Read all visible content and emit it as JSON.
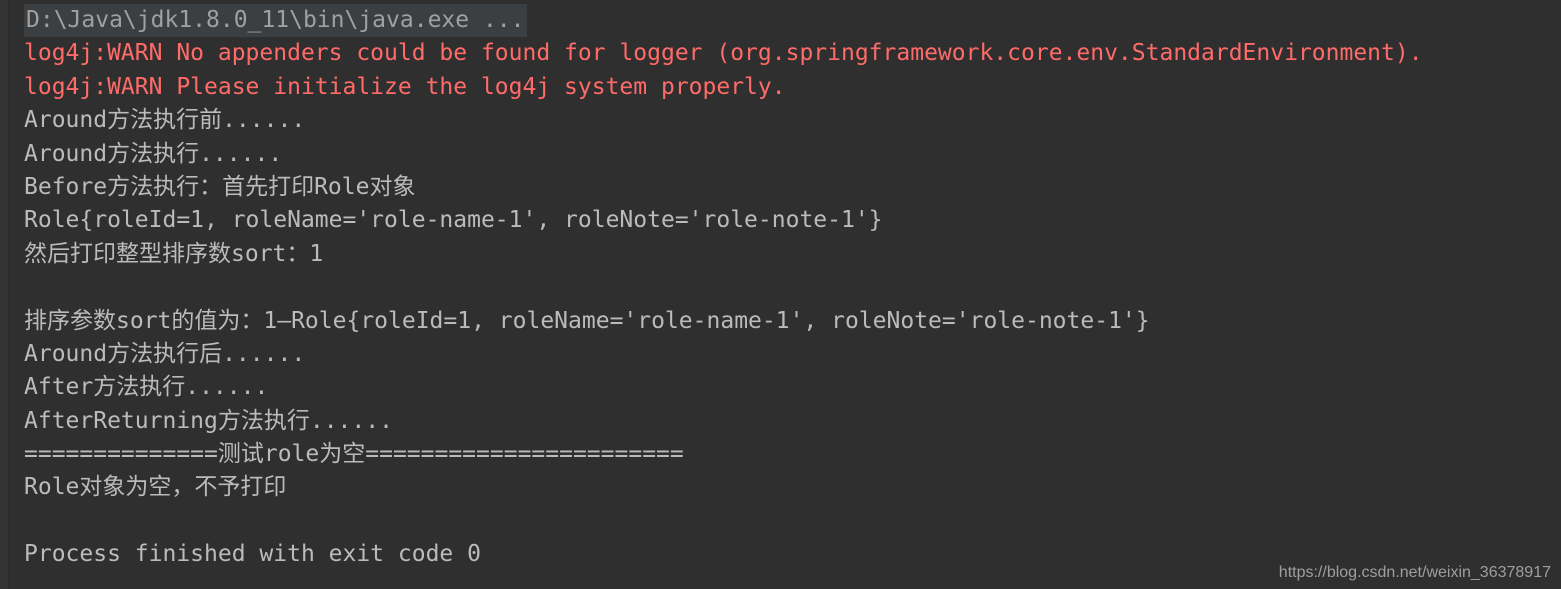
{
  "window": {
    "title": "Run console output",
    "background_color": "#2f2f2f",
    "text_color": "#bbbbbb",
    "error_color": "#ff6b68",
    "highlight_color": "#3c3f41"
  },
  "console": {
    "lines": [
      {
        "id": "command-line",
        "kind": "command",
        "text": "D:\\Java\\jdk1.8.0_11\\bin\\java.exe ..."
      },
      {
        "id": "log4j-warn-1",
        "kind": "error",
        "text": "log4j:WARN No appenders could be found for logger (org.springframework.core.env.StandardEnvironment)."
      },
      {
        "id": "log4j-warn-2",
        "kind": "error",
        "text": "log4j:WARN Please initialize the log4j system properly."
      },
      {
        "id": "around-before",
        "kind": "output",
        "text": "Around方法执行前......"
      },
      {
        "id": "around-proceed",
        "kind": "output",
        "text": "Around方法执行......"
      },
      {
        "id": "before-advice",
        "kind": "output",
        "text": "Before方法执行：首先打印Role对象"
      },
      {
        "id": "role-to-string",
        "kind": "output",
        "text": "Role{roleId=1, roleName='role-name-1', roleNote='role-note-1'}"
      },
      {
        "id": "print-sort",
        "kind": "output",
        "text": "然后打印整型排序数sort：1"
      },
      {
        "id": "blank-1",
        "kind": "blank",
        "text": ""
      },
      {
        "id": "sort-value",
        "kind": "output",
        "text": "排序参数sort的值为：1—Role{roleId=1, roleName='role-name-1', roleNote='role-note-1'}"
      },
      {
        "id": "around-after",
        "kind": "output",
        "text": "Around方法执行后......"
      },
      {
        "id": "after-advice",
        "kind": "output",
        "text": "After方法执行......"
      },
      {
        "id": "after-returning",
        "kind": "output",
        "text": "AfterReturning方法执行......"
      },
      {
        "id": "divider-null-role",
        "kind": "output",
        "text": "==============测试role为空======================="
      },
      {
        "id": "role-null-msg",
        "kind": "output",
        "text": "Role对象为空，不予打印"
      },
      {
        "id": "blank-2",
        "kind": "blank",
        "text": ""
      },
      {
        "id": "process-finished",
        "kind": "output",
        "text": "Process finished with exit code 0"
      }
    ]
  },
  "watermark": {
    "text": "https://blog.csdn.net/weixin_36378917"
  }
}
